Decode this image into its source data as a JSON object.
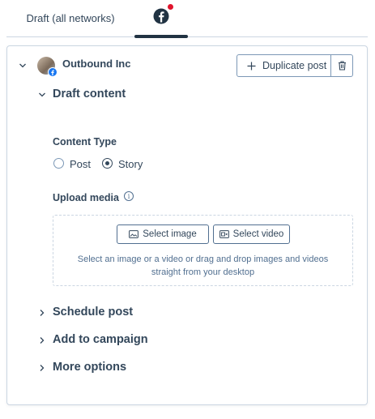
{
  "tabs": {
    "draft_label": "Draft (all networks)"
  },
  "account": {
    "name": "Outbound Inc"
  },
  "actions": {
    "duplicate_label": "Duplicate post"
  },
  "draft_section": {
    "title": "Draft content",
    "content_type_label": "Content Type",
    "options": [
      "Post",
      "Story"
    ],
    "selected": "Story",
    "upload_label": "Upload media",
    "select_image_label": "Select image",
    "select_video_label": "Select video",
    "drop_hint_line1": "Select an image or a video or drag and drop images and videos",
    "drop_hint_line2": "straight from your desktop"
  },
  "sections": {
    "schedule": "Schedule post",
    "campaign": "Add to campaign",
    "more": "More options"
  },
  "colors": {
    "text": "#33475b",
    "border": "#cbd6e2",
    "facebook_blue": "#1877f2",
    "notification_red": "#e0142c",
    "active_tab_underline": "#213343"
  }
}
